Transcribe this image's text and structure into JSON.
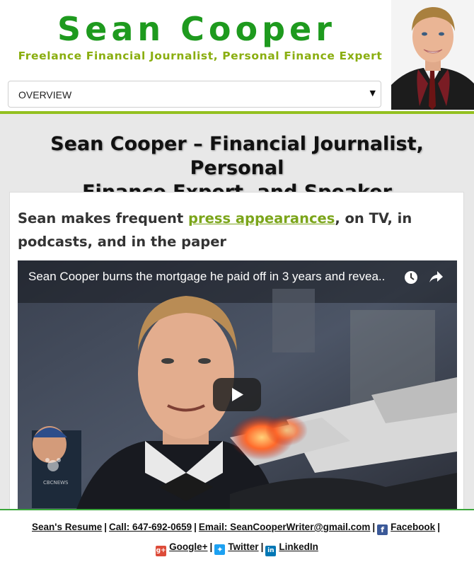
{
  "header": {
    "site_title": "Sean Cooper",
    "tagline": "Freelance Financial Journalist, Personal Finance Expert",
    "nav_selected": "OVERVIEW"
  },
  "main": {
    "heading_line1": "Sean Cooper – Financial Journalist, Personal",
    "heading_line2": "Finance Expert, and Speaker",
    "intro_before": "Sean makes frequent ",
    "intro_link": "press appearances",
    "intro_after": ", on TV, in podcasts, and in the paper",
    "video_title": "Sean Cooper burns the mortgage he paid off in 3 years and revea..",
    "video_watermark": "CBCNEWS"
  },
  "footer": {
    "resume": "Sean's Resume",
    "call": "Call: 647-692-0659",
    "email": "Email: SeanCooperWriter@gmail.com",
    "facebook": "Facebook",
    "googleplus": "Google+",
    "twitter": "Twitter",
    "linkedin": "LinkedIn",
    "separator": "|"
  },
  "colors": {
    "title_green": "#1e9a1e",
    "tagline_green": "#8aae10",
    "accent": "#93c01f",
    "link": "#7ba51a",
    "facebook": "#3b5998",
    "googleplus": "#dd4b39",
    "twitter": "#1da1f2",
    "linkedin": "#0077b5"
  },
  "icons": [
    "facebook-icon",
    "googleplus-icon",
    "twitter-icon",
    "linkedin-icon",
    "clock-icon",
    "share-icon",
    "play-icon",
    "dropdown-arrow-icon"
  ]
}
